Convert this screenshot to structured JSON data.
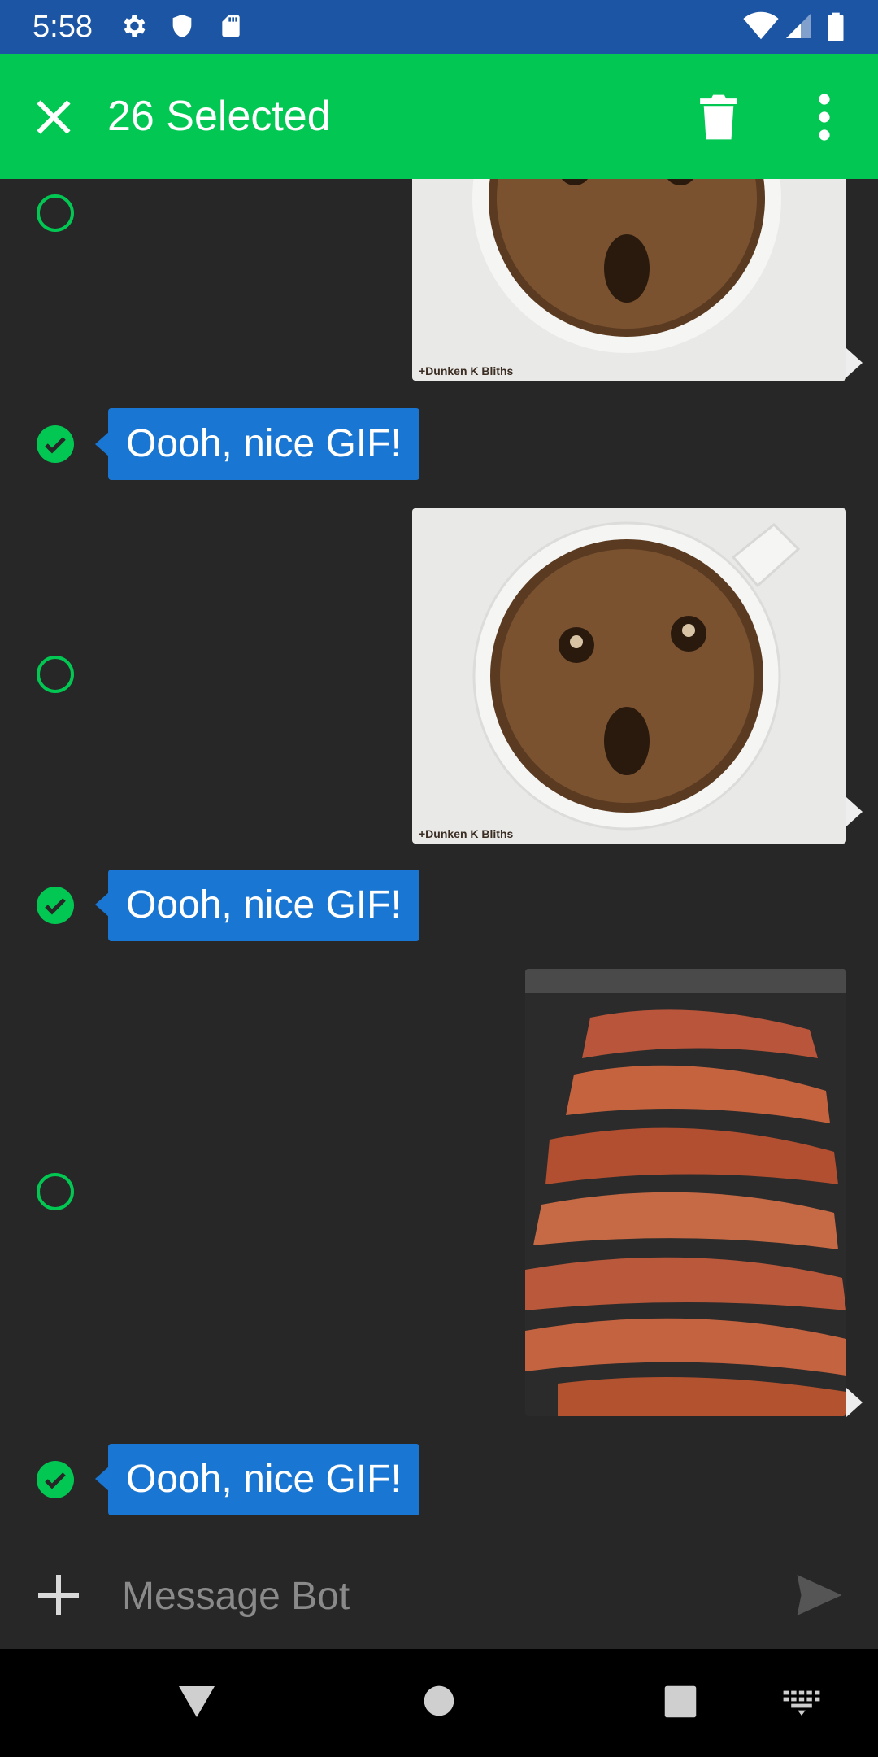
{
  "status_bar": {
    "time": "5:58",
    "icons": [
      "gear-icon",
      "shield-icon",
      "sd-card-icon",
      "wifi-icon",
      "signal-icon",
      "battery-icon"
    ]
  },
  "toolbar": {
    "title": "26 Selected",
    "close_icon": "close-icon",
    "delete_icon": "trash-icon",
    "more_icon": "more-vert-icon",
    "background": "#02c853"
  },
  "messages": [
    {
      "type": "image",
      "subject": "coffee",
      "caption": "+Dunken K Bliths",
      "selected": false
    },
    {
      "type": "text",
      "text": "Oooh, nice GIF!",
      "selected": true
    },
    {
      "type": "image",
      "subject": "coffee",
      "caption": "+Dunken K Bliths",
      "selected": false
    },
    {
      "type": "text",
      "text": "Oooh, nice GIF!",
      "selected": true
    },
    {
      "type": "image",
      "subject": "bacon",
      "selected": false
    },
    {
      "type": "text",
      "text": "Oooh, nice GIF!",
      "selected": true
    }
  ],
  "composer": {
    "placeholder": "Message Bot",
    "add_icon": "plus-icon",
    "send_icon": "send-icon"
  },
  "nav_bar": {
    "icons": [
      "back-icon",
      "home-icon",
      "recents-icon",
      "keyboard-icon"
    ]
  },
  "colors": {
    "status_bar": "#1b55a3",
    "accent": "#02c853",
    "bubble": "#1976d2",
    "background": "#272727"
  }
}
